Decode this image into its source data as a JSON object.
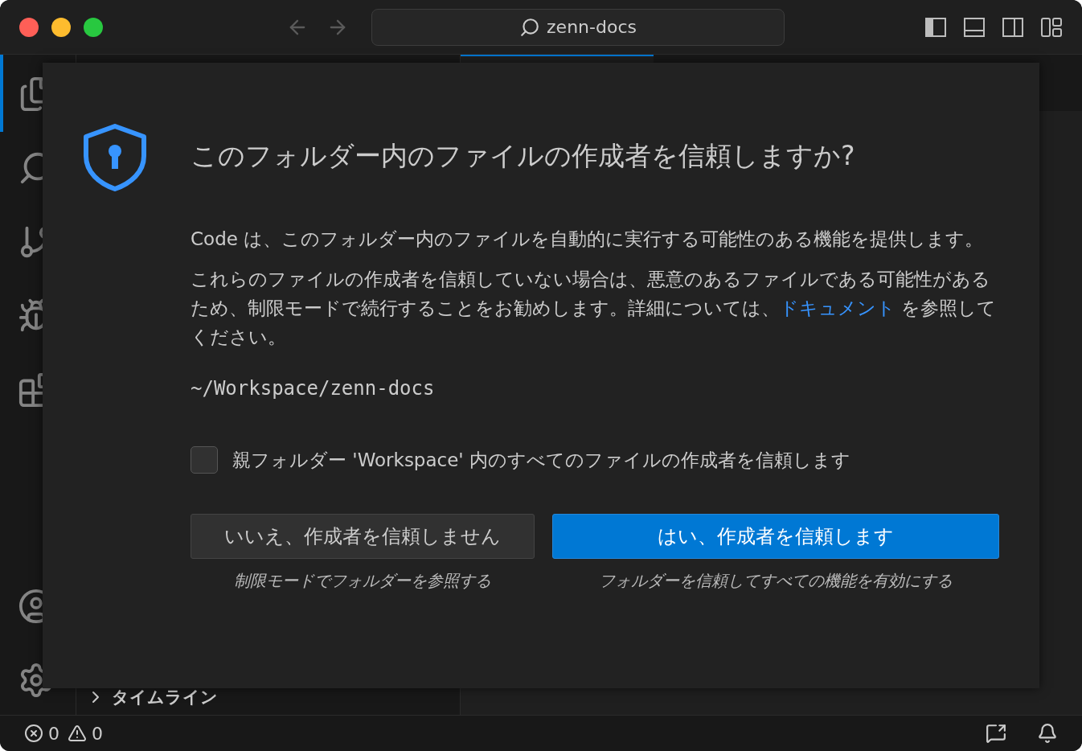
{
  "window": {
    "search": "zenn-docs"
  },
  "sidebar": {
    "timeline": {
      "label": "タイムライン",
      "expanded": false
    }
  },
  "dialog": {
    "title": "このフォルダー内のファイルの作成者を信頼しますか?",
    "paragraphs": [
      {
        "before": "Code は、このフォルダー内のファイルを自動的に実行する可能性のある機能を提供します。"
      },
      {
        "before": "これらのファイルの作成者を信頼していない場合は、悪意のあるファイルである可能性があるため、制限モードで続行することをお勧めします。詳細については、",
        "link": "ドキュメント",
        "after": " を参照してください。"
      }
    ],
    "path": "~/Workspace/zenn-docs",
    "checkbox": {
      "label": "親フォルダー 'Workspace' 内のすべてのファイルの作成者を信頼します",
      "checked": false
    },
    "buttons": [
      {
        "kind": "secondary",
        "label": "いいえ、作成者を信頼しません",
        "caption": "制限モードでフォルダーを参照する"
      },
      {
        "kind": "primary",
        "label": "はい、作成者を信頼します",
        "caption": "フォルダーを信頼してすべての機能を有効にする"
      }
    ]
  },
  "status_bar": {
    "errors": "0",
    "warnings": "0"
  }
}
